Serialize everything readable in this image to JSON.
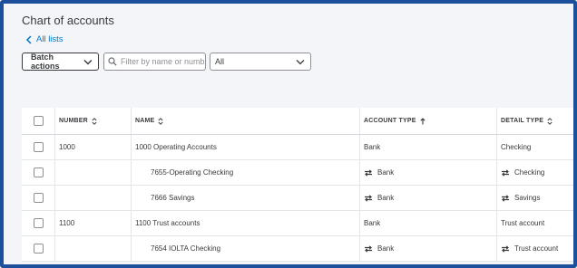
{
  "page": {
    "title": "Chart of accounts"
  },
  "nav": {
    "all_lists_label": "All lists"
  },
  "toolbar": {
    "batch_actions_label": "Batch actions",
    "search_placeholder": "Filter by name or number",
    "type_filter_value": "All"
  },
  "table": {
    "columns": {
      "number": "NUMBER",
      "name": "NAME",
      "account_type": "ACCOUNT TYPE",
      "detail_type": "DETAIL TYPE"
    },
    "rows": [
      {
        "number": "1000",
        "name": "1000 Operating Accounts",
        "account_type": "Bank",
        "detail_type": "Checking",
        "subaccount": false
      },
      {
        "number": "",
        "name": "7655-Operating Checking",
        "account_type": "Bank",
        "detail_type": "Checking",
        "subaccount": true
      },
      {
        "number": "",
        "name": "7666 Savings",
        "account_type": "Bank",
        "detail_type": "Savings",
        "subaccount": true
      },
      {
        "number": "1100",
        "name": "1100 Trust accounts",
        "account_type": "Bank",
        "detail_type": "Trust account",
        "subaccount": false
      },
      {
        "number": "",
        "name": "7654 IOLTA Checking",
        "account_type": "Bank",
        "detail_type": "Trust account",
        "subaccount": true
      }
    ]
  },
  "colors": {
    "frame_border": "#1c4f9c",
    "link": "#0077c5",
    "background": "#f4f5f8"
  }
}
